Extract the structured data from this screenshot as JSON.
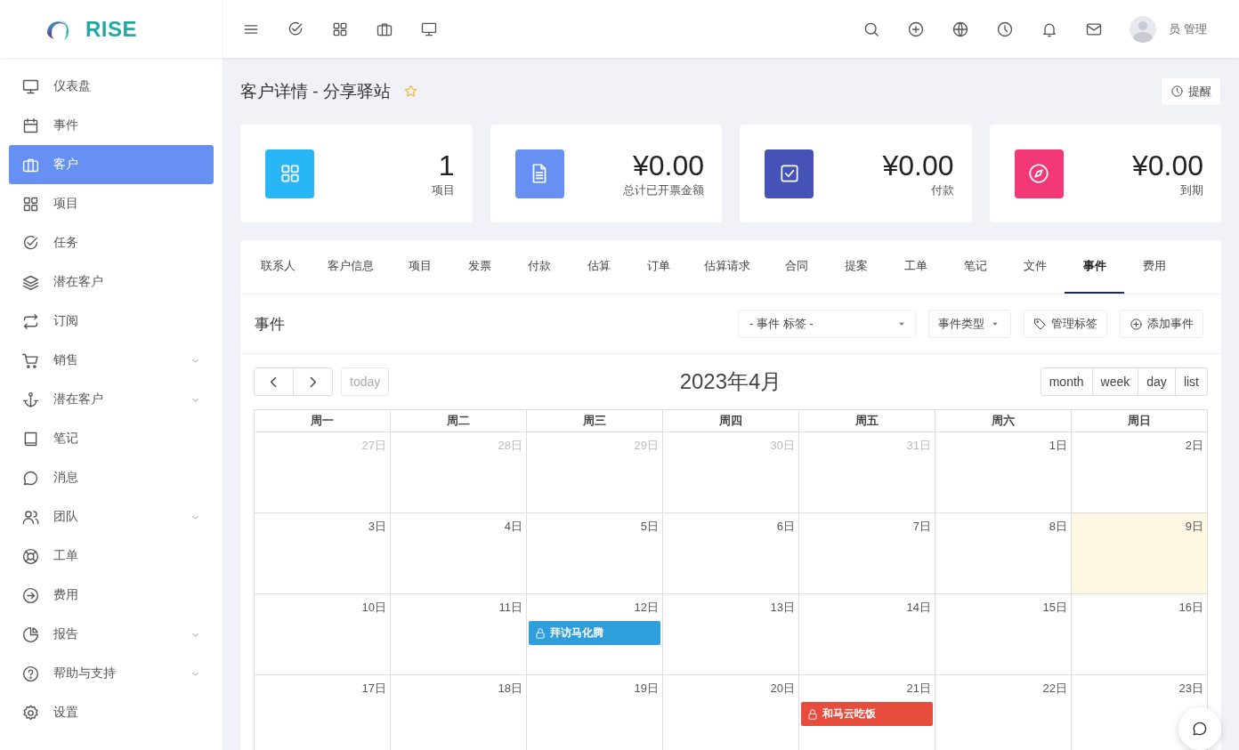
{
  "brand": {
    "name": "RISE"
  },
  "topbar": {
    "user": {
      "name": "员 管理"
    }
  },
  "sidebar": {
    "items": [
      {
        "label": "仪表盘",
        "selected": false,
        "expandable": false
      },
      {
        "label": "事件",
        "selected": false,
        "expandable": false
      },
      {
        "label": "客户",
        "selected": true,
        "expandable": false
      },
      {
        "label": "项目",
        "selected": false,
        "expandable": false
      },
      {
        "label": "任务",
        "selected": false,
        "expandable": false
      },
      {
        "label": "潜在客户",
        "selected": false,
        "expandable": false
      },
      {
        "label": "订阅",
        "selected": false,
        "expandable": false
      },
      {
        "label": "销售",
        "selected": false,
        "expandable": true
      },
      {
        "label": "潜在客户",
        "selected": false,
        "expandable": true
      },
      {
        "label": "笔记",
        "selected": false,
        "expandable": false
      },
      {
        "label": "消息",
        "selected": false,
        "expandable": false
      },
      {
        "label": "团队",
        "selected": false,
        "expandable": true
      },
      {
        "label": "工单",
        "selected": false,
        "expandable": false
      },
      {
        "label": "费用",
        "selected": false,
        "expandable": false
      },
      {
        "label": "报告",
        "selected": false,
        "expandable": true
      },
      {
        "label": "帮助与支持",
        "selected": false,
        "expandable": true
      },
      {
        "label": "设置",
        "selected": false,
        "expandable": false
      }
    ]
  },
  "page": {
    "title": "客户详情 - 分享驿站",
    "favorite": false,
    "reminder_button": "提醒"
  },
  "stats": [
    {
      "value": "1",
      "label": "项目",
      "color": "#29b6f6"
    },
    {
      "value": "¥0.00",
      "label": "总计已开票金额",
      "color": "#6690f4"
    },
    {
      "value": "¥0.00",
      "label": "付款",
      "color": "#4453b5"
    },
    {
      "value": "¥0.00",
      "label": "到期",
      "color": "#f33878"
    }
  ],
  "tabs": [
    {
      "label": "联系人",
      "selected": false
    },
    {
      "label": "客户信息",
      "selected": false
    },
    {
      "label": "项目",
      "selected": false
    },
    {
      "label": "发票",
      "selected": false
    },
    {
      "label": "付款",
      "selected": false
    },
    {
      "label": "估算",
      "selected": false
    },
    {
      "label": "订单",
      "selected": false
    },
    {
      "label": "估算请求",
      "selected": false
    },
    {
      "label": "合同",
      "selected": false
    },
    {
      "label": "提案",
      "selected": false
    },
    {
      "label": "工单",
      "selected": false
    },
    {
      "label": "笔记",
      "selected": false
    },
    {
      "label": "文件",
      "selected": false
    },
    {
      "label": "事件",
      "selected": true
    },
    {
      "label": "费用",
      "selected": false
    }
  ],
  "events_panel": {
    "title": "事件",
    "tag_select": {
      "value": "- 事件 标签 -"
    },
    "type_button": "事件类型",
    "manage_tags_button": "管理标签",
    "add_button": "添加事件"
  },
  "calendar": {
    "title": "2023年4月",
    "today_button": {
      "label": "today",
      "disabled": true
    },
    "views": [
      "month",
      "week",
      "day",
      "list"
    ],
    "weekdays": [
      "周一",
      "周二",
      "周三",
      "周四",
      "周五",
      "周六",
      "周日"
    ],
    "weeks": [
      [
        {
          "label": "27日",
          "other_month": true,
          "today": false
        },
        {
          "label": "28日",
          "other_month": true,
          "today": false
        },
        {
          "label": "29日",
          "other_month": true,
          "today": false
        },
        {
          "label": "30日",
          "other_month": true,
          "today": false
        },
        {
          "label": "31日",
          "other_month": true,
          "today": false
        },
        {
          "label": "1日",
          "other_month": false,
          "today": false
        },
        {
          "label": "2日",
          "other_month": false,
          "today": false
        }
      ],
      [
        {
          "label": "3日",
          "other_month": false,
          "today": false
        },
        {
          "label": "4日",
          "other_month": false,
          "today": false
        },
        {
          "label": "5日",
          "other_month": false,
          "today": false
        },
        {
          "label": "6日",
          "other_month": false,
          "today": false
        },
        {
          "label": "7日",
          "other_month": false,
          "today": false
        },
        {
          "label": "8日",
          "other_month": false,
          "today": false
        },
        {
          "label": "9日",
          "other_month": false,
          "today": true
        }
      ],
      [
        {
          "label": "10日",
          "other_month": false,
          "today": false
        },
        {
          "label": "11日",
          "other_month": false,
          "today": false
        },
        {
          "label": "12日",
          "other_month": false,
          "today": false,
          "events": [
            {
              "title": "拜访马化腾",
              "color": "#2e9fdc"
            }
          ]
        },
        {
          "label": "13日",
          "other_month": false,
          "today": false
        },
        {
          "label": "14日",
          "other_month": false,
          "today": false
        },
        {
          "label": "15日",
          "other_month": false,
          "today": false
        },
        {
          "label": "16日",
          "other_month": false,
          "today": false
        }
      ],
      [
        {
          "label": "17日",
          "other_month": false,
          "today": false
        },
        {
          "label": "18日",
          "other_month": false,
          "today": false
        },
        {
          "label": "19日",
          "other_month": false,
          "today": false
        },
        {
          "label": "20日",
          "other_month": false,
          "today": false
        },
        {
          "label": "21日",
          "other_month": false,
          "today": false,
          "events": [
            {
              "title": "和马云吃饭",
              "color": "#e74c3c"
            }
          ]
        },
        {
          "label": "22日",
          "other_month": false,
          "today": false
        },
        {
          "label": "23日",
          "other_month": false,
          "today": false
        }
      ]
    ]
  }
}
